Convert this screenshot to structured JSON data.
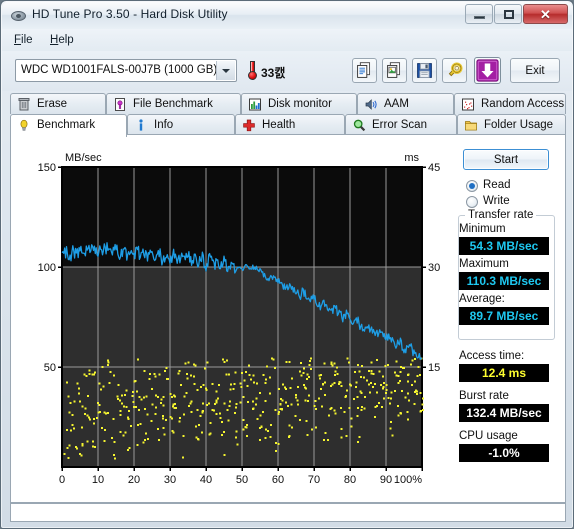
{
  "window": {
    "title": "HD Tune Pro 3.50 - Hard Disk Utility",
    "minimize_label": "",
    "maximize_label": "",
    "close_label": "✕"
  },
  "menu": {
    "items": [
      {
        "label": "File",
        "accel": "F"
      },
      {
        "label": "Help",
        "accel": "H"
      }
    ]
  },
  "toolbar": {
    "drive_selected": "WDC WD1001FALS-00J7B (1000 GB)",
    "temperature": "33캜",
    "exit_label": "Exit",
    "buttons": [
      {
        "name": "copy-text-icon",
        "tip": "Copy text"
      },
      {
        "name": "copy-image-icon",
        "tip": "Copy image"
      },
      {
        "name": "save-icon",
        "tip": "Save"
      },
      {
        "name": "options-icon",
        "tip": "Options"
      },
      {
        "name": "download-icon",
        "tip": "Download"
      }
    ]
  },
  "tabs": {
    "top_row": [
      {
        "label": "Erase",
        "icon": "trash-icon",
        "active": false
      },
      {
        "label": "File Benchmark",
        "icon": "file-benchmark-icon",
        "active": false
      },
      {
        "label": "Disk monitor",
        "icon": "bar-chart-icon",
        "active": false
      },
      {
        "label": "AAM",
        "icon": "speaker-icon",
        "active": false
      },
      {
        "label": "Random Access",
        "icon": "random-access-icon",
        "active": false
      }
    ],
    "bottom_row": [
      {
        "label": "Benchmark",
        "icon": "bulb-icon",
        "active": true
      },
      {
        "label": "Info",
        "icon": "info-icon",
        "active": false
      },
      {
        "label": "Health",
        "icon": "cross-icon",
        "active": false
      },
      {
        "label": "Error Scan",
        "icon": "magnifier-icon",
        "active": false
      },
      {
        "label": "Folder Usage",
        "icon": "folder-icon",
        "active": false
      }
    ]
  },
  "results": {
    "start_label": "Start",
    "mode_read_label": "Read",
    "mode_write_label": "Write",
    "mode_selected": "Read",
    "transfer_group_title": "Transfer rate",
    "minimum_label": "Minimum",
    "minimum_value": "54.3 MB/sec",
    "maximum_label": "Maximum",
    "maximum_value": "110.3 MB/sec",
    "average_label": "Average:",
    "average_value": "89.7 MB/sec",
    "access_label": "Access time:",
    "access_value": "12.4 ms",
    "burst_label": "Burst rate",
    "burst_value": "132.4 MB/sec",
    "cpu_label": "CPU usage",
    "cpu_value": "-1.0%"
  },
  "colors": {
    "transfer_curve": "#1e9ee6",
    "access_dots": "#f5f530",
    "plot_background_top": "#0b0b0b",
    "plot_background_bottom": "#2e2e2e",
    "grid": "#9a9a9a",
    "value_cyan": "#1ec8f0",
    "value_yellow": "#ffff30"
  },
  "chart_data": {
    "type": "line",
    "title": "",
    "xlabel": "",
    "ylabel": "MB/sec",
    "y2label": "ms",
    "xlim": [
      0,
      100
    ],
    "ylim": [
      0,
      150
    ],
    "y2lim": [
      0,
      45
    ],
    "xticks": [
      0,
      10,
      20,
      30,
      40,
      50,
      60,
      70,
      80,
      90,
      100
    ],
    "xticklabels": [
      "0",
      "10",
      "20",
      "30",
      "40",
      "50",
      "60",
      "70",
      "80",
      "90",
      "100%"
    ],
    "yticks": [
      50,
      100,
      150
    ],
    "yticklabels": [
      "50",
      "100",
      "150"
    ],
    "y2ticks": [
      15,
      30,
      45
    ],
    "y2ticklabels": [
      "15",
      "30",
      "45"
    ],
    "grid": true,
    "legend": "none",
    "series": [
      {
        "name": "Transfer rate",
        "type": "line",
        "color": "#1e9ee6",
        "axis": "left",
        "units": "MB/sec",
        "x": [
          0,
          1,
          2,
          3,
          4,
          5,
          6,
          7,
          8,
          9,
          10,
          11,
          12,
          13,
          14,
          15,
          16,
          17,
          18,
          19,
          20,
          21,
          22,
          23,
          24,
          25,
          26,
          27,
          28,
          29,
          30,
          31,
          32,
          33,
          34,
          35,
          36,
          37,
          38,
          39,
          40,
          41,
          42,
          43,
          44,
          45,
          46,
          47,
          48,
          49,
          50,
          51,
          52,
          53,
          54,
          55,
          56,
          57,
          58,
          59,
          60,
          61,
          62,
          63,
          64,
          65,
          66,
          67,
          68,
          69,
          70,
          71,
          72,
          73,
          74,
          75,
          76,
          77,
          78,
          79,
          80,
          81,
          82,
          83,
          84,
          85,
          86,
          87,
          88,
          89,
          90,
          91,
          92,
          93,
          94,
          95,
          96,
          97,
          98,
          99,
          100
        ],
        "y": [
          105.5,
          107.8,
          104.6,
          108.4,
          105.1,
          109.2,
          106.0,
          110.3,
          107.1,
          109.6,
          106.4,
          110.0,
          107.6,
          109.9,
          106.8,
          109.4,
          105.9,
          108.8,
          105.2,
          108.2,
          104.8,
          107.9,
          104.4,
          107.5,
          104.0,
          107.1,
          103.7,
          106.8,
          103.3,
          106.4,
          103.0,
          106.0,
          102.6,
          105.6,
          102.2,
          105.2,
          101.8,
          104.8,
          101.4,
          104.3,
          101.0,
          103.8,
          100.3,
          103.2,
          99.6,
          102.6,
          98.9,
          101.9,
          97.4,
          100.0,
          98.6,
          100.4,
          99.8,
          100.1,
          99.4,
          98.6,
          96.2,
          93.8,
          95.0,
          94.2,
          93.0,
          91.6,
          90.2,
          88.8,
          89.6,
          87.4,
          86.0,
          87.2,
          84.6,
          83.2,
          84.4,
          81.8,
          80.4,
          81.6,
          79.0,
          77.6,
          78.8,
          76.2,
          74.8,
          76.0,
          73.4,
          72.0,
          73.2,
          70.6,
          69.2,
          70.4,
          67.8,
          66.4,
          67.6,
          65.0,
          63.6,
          64.8,
          62.2,
          60.8,
          62.0,
          59.4,
          58.0,
          59.2,
          56.6,
          55.2,
          54.3
        ]
      },
      {
        "name": "Access time",
        "type": "scatter",
        "color": "#f5f530",
        "axis": "right",
        "units": "ms",
        "average": 12.4,
        "x": [
          1,
          2,
          3,
          4,
          5,
          6,
          7,
          8,
          9,
          10,
          11,
          12,
          13,
          14,
          15,
          16,
          17,
          18,
          19,
          20,
          21,
          22,
          23,
          24,
          25,
          26,
          27,
          28,
          29,
          30,
          31,
          32,
          33,
          34,
          35,
          36,
          37,
          38,
          39,
          40,
          41,
          42,
          43,
          44,
          45,
          46,
          47,
          48,
          49,
          50,
          51,
          52,
          53,
          54,
          55,
          56,
          57,
          58,
          59,
          60,
          61,
          62,
          63,
          64,
          65,
          66,
          67,
          68,
          69,
          70,
          71,
          72,
          73,
          74,
          75,
          76,
          77,
          78,
          79,
          80,
          81,
          82,
          83,
          84,
          85,
          86,
          87,
          88,
          89,
          90,
          91,
          92,
          93,
          94,
          95,
          96,
          97,
          98,
          99,
          100
        ],
        "y": [
          4.1,
          9.2,
          6.5,
          12.0,
          3.4,
          10.8,
          7.6,
          13.5,
          5.0,
          8.8,
          11.9,
          6.2,
          14.2,
          4.6,
          10.1,
          7.9,
          12.6,
          5.5,
          9.6,
          13.0,
          6.8,
          11.2,
          4.2,
          8.4,
          12.9,
          7.1,
          10.5,
          5.8,
          13.8,
          9.0,
          6.4,
          11.6,
          4.8,
          14.0,
          8.2,
          12.3,
          5.3,
          10.2,
          7.4,
          13.2,
          6.0,
          11.0,
          9.4,
          4.5,
          12.8,
          8.6,
          14.4,
          5.9,
          10.7,
          7.2,
          13.6,
          6.6,
          11.4,
          9.8,
          4.9,
          12.5,
          8.0,
          14.6,
          6.3,
          10.9,
          7.8,
          13.3,
          5.6,
          11.8,
          9.1,
          15.0,
          12.2,
          8.5,
          14.8,
          6.9,
          10.4,
          13.9,
          7.5,
          12.1,
          9.5,
          15.2,
          11.5,
          8.1,
          14.1,
          10.0,
          13.4,
          6.7,
          12.7,
          9.9,
          15.4,
          11.1,
          8.9,
          14.5,
          10.6,
          13.1,
          7.3,
          12.4,
          9.3,
          15.6,
          11.7,
          8.7,
          14.9,
          10.3,
          13.7,
          12.0
        ]
      }
    ]
  },
  "statusbar": {
    "text": ""
  }
}
